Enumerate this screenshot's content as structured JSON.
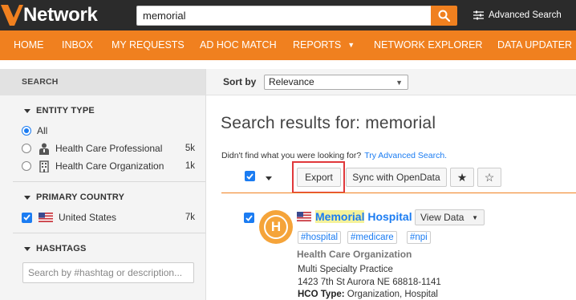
{
  "header": {
    "logo_text": "Network",
    "search_value": "memorial",
    "advanced_search_label": "Advanced Search"
  },
  "nav": {
    "items": [
      {
        "label": "HOME"
      },
      {
        "label": "INBOX"
      },
      {
        "label": "MY REQUESTS"
      },
      {
        "label": "AD HOC MATCH"
      },
      {
        "label": "REPORTS",
        "has_dropdown": true
      },
      {
        "label": "NETWORK EXPLORER"
      },
      {
        "label": "DATA UPDATER"
      }
    ]
  },
  "sidebar": {
    "title": "SEARCH",
    "entity_type": {
      "title": "ENTITY TYPE",
      "options": [
        {
          "label": "All",
          "selected": true
        },
        {
          "label": "Health Care Professional",
          "count": "5k",
          "icon": "person-icon"
        },
        {
          "label": "Health Care Organization",
          "count": "1k",
          "icon": "building-icon"
        }
      ]
    },
    "primary_country": {
      "title": "PRIMARY COUNTRY",
      "options": [
        {
          "label": "United States",
          "count": "7k",
          "checked": true,
          "icon": "us-flag-icon"
        }
      ]
    },
    "hashtags": {
      "title": "HASHTAGS",
      "placeholder": "Search by #hashtag or description..."
    }
  },
  "main": {
    "sort_label": "Sort by",
    "sort_value": "Relevance",
    "results_title": "Search results for: memorial",
    "hint_text": "Didn't find what you were looking for?",
    "hint_link": "Try Advanced Search.",
    "toolbar": {
      "export_label": "Export",
      "sync_label": "Sync with OpenData",
      "star_filled": "★",
      "star_outline": "☆"
    },
    "result": {
      "avatar_letter": "H",
      "name_highlight": "Memorial",
      "name_rest": " Hospital",
      "view_data_label": "View Data",
      "tags": [
        "#hospital",
        "#medicare",
        "#npi"
      ],
      "type": "Health Care Organization",
      "specialty": "Multi Specialty Practice",
      "address": "1423 7th St Aurora NE 68818-1141",
      "hco_type_label": "HCO Type:",
      "hco_type_value": "Organization, Hospital"
    }
  },
  "colors": {
    "brand_orange": "#f0801f",
    "header_dark": "#2b2b2b",
    "link_blue": "#1b7cf2",
    "highlight_red": "#e0383b"
  }
}
